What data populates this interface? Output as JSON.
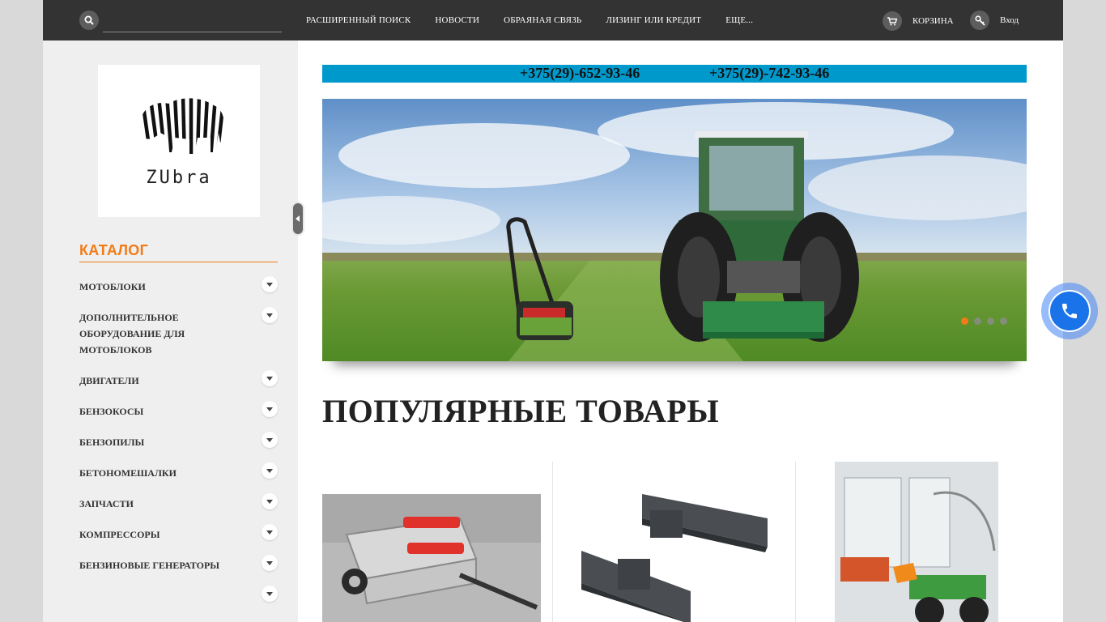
{
  "header": {
    "search_placeholder": "",
    "nav": [
      "РАСШИРЕННЫЙ ПОИСК",
      "НОВОСТИ",
      "ОБРАЯНАЯ СВЯЗЬ",
      "ЛИЗИНГ ИЛИ КРЕДИТ",
      "ЕЩЕ..."
    ],
    "cart_label": "КОРЗИНА",
    "login_label": "Вход"
  },
  "sidebar": {
    "logo_text": "ZUbra",
    "catalog_title": "КАТАЛОГ",
    "categories": [
      "МОТОБЛОКИ",
      "ДОПОЛНИТЕЛЬНОЕ ОБОРУДОВАНИЕ ДЛЯ МОТОБЛОКОВ",
      "ДВИГАТЕЛИ",
      "БЕНЗОКОСЫ",
      "БЕНЗОПИЛЫ",
      "БЕТОНОМЕШАЛКИ",
      "ЗАПЧАСТИ",
      "КОМПРЕССОРЫ",
      "БЕНЗИНОВЫЕ ГЕНЕРАТОРЫ"
    ]
  },
  "main": {
    "phone_1": "+375(29)-652-93-46",
    "phone_2": "+375(29)-742-93-46",
    "slider_slides": 4,
    "slider_active": 1,
    "popular_title": "ПОПУЛЯРНЫЕ ТОВАРЫ"
  },
  "colors": {
    "topbar": "#333333",
    "accent_orange": "#f07b18",
    "phone_bar": "#0099cc",
    "call_button": "#1a73e8"
  },
  "icons": [
    "search-icon",
    "cart-icon",
    "key-icon",
    "chevron-down-icon",
    "phone-icon",
    "collapse-left-icon"
  ]
}
